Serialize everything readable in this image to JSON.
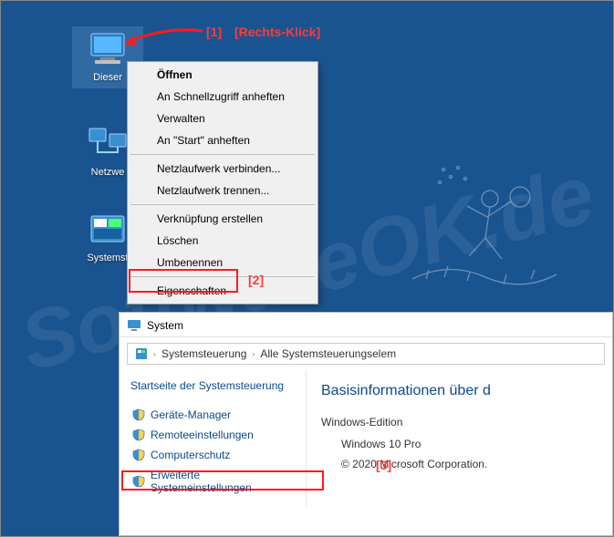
{
  "watermark": "SoftwareOK.de",
  "annotations": {
    "a1": "[1]",
    "a1_label": "[Rechts-Klick]",
    "a2": "[2]",
    "a3": "[3]"
  },
  "desktop_icons": {
    "computer": {
      "label": "Dieser"
    },
    "network": {
      "label": "Netzwe"
    },
    "settings": {
      "label": "Systemst"
    }
  },
  "context_menu": {
    "open": "Öffnen",
    "pin_quick": "An Schnellzugriff anheften",
    "manage": "Verwalten",
    "pin_start": "An \"Start\" anheften",
    "map_drive": "Netzlaufwerk verbinden...",
    "disconnect_drive": "Netzlaufwerk trennen...",
    "create_shortcut": "Verknüpfung erstellen",
    "delete": "Löschen",
    "rename": "Umbenennen",
    "properties": "Eigenschaften"
  },
  "system_window": {
    "title": "System",
    "breadcrumb": {
      "control_panel": "Systemsteuerung",
      "all_items": "Alle Systemsteuerungselem"
    },
    "left_panel": {
      "home": "Startseite der Systemsteuerung",
      "links": {
        "device_manager": "Geräte-Manager",
        "remote_settings": "Remoteeinstellungen",
        "system_protection": "Computerschutz",
        "advanced_settings": "Erweiterte Systemeinstellungen"
      }
    },
    "right_panel": {
      "heading": "Basisinformationen über d",
      "edition_label": "Windows-Edition",
      "edition_value": "Windows 10 Pro",
      "copyright": "© 2020 Microsoft Corporation."
    }
  }
}
